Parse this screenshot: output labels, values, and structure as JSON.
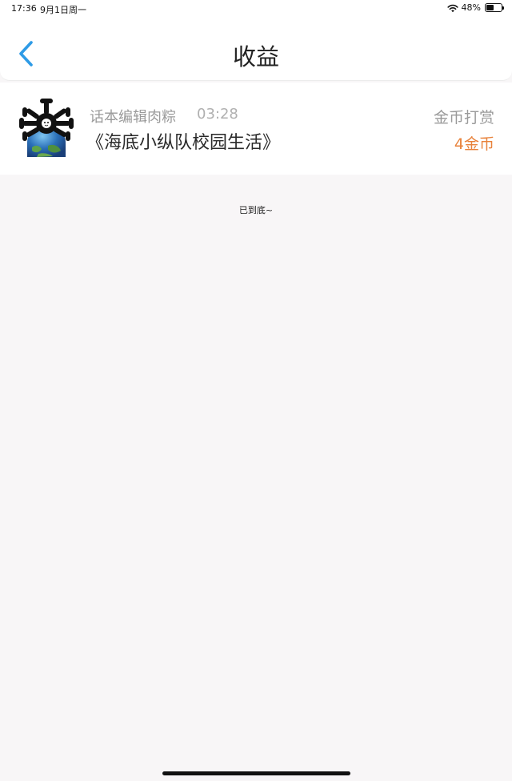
{
  "status_bar": {
    "time": "17:36",
    "date": "9月1日周一",
    "battery": "48%",
    "battery_level": 0.48
  },
  "header": {
    "title": "收益",
    "back_icon": "chevron-left-icon",
    "accent_color": "#2e9be6"
  },
  "records": [
    {
      "editor": "话本编辑肉粽",
      "time": "03:28",
      "title": "《海底小纵队校园生活》",
      "reward_type": "金币打赏",
      "amount": "4金币",
      "amount_color": "#e8823b"
    }
  ],
  "footer": {
    "end_text": "已到底~"
  }
}
